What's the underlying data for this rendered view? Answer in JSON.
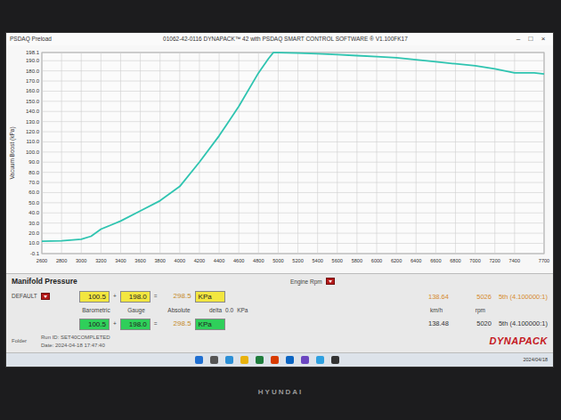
{
  "window": {
    "app_name": "PSDAQ Preload",
    "title": "01062-42-0116 DYNAPACK™ 42 with PSDAQ SMART CONTROL SOFTWARE ® V1.100FK17",
    "controls": [
      "–",
      "□",
      "×"
    ]
  },
  "chart": {
    "y_axis_label": "Vacuum Boost (kPa)",
    "x_axis_label": "Engine Rpm",
    "y_ticks": [
      "198.1",
      "190.0",
      "180.0",
      "170.0",
      "160.0",
      "150.0",
      "140.0",
      "130.0",
      "120.0",
      "110.0",
      "100.0",
      "90.0",
      "80.0",
      "70.0",
      "60.0",
      "50.0",
      "40.0",
      "30.0",
      "20.0",
      "10.0",
      "-0.1"
    ],
    "x_ticks": [
      "2600",
      "2800",
      "3000",
      "3200",
      "3400",
      "3600",
      "3800",
      "4000",
      "4200",
      "4400",
      "4600",
      "4800",
      "5000",
      "5200",
      "5400",
      "5600",
      "5800",
      "6000",
      "6200",
      "6400",
      "6600",
      "6800",
      "7000",
      "7200",
      "7400",
      "7700"
    ],
    "series": [
      {
        "name": "Manifold Pressure",
        "color": "#2ec4b0",
        "rpm": [
          2600,
          2800,
          3000,
          3100,
          3200,
          3300,
          3400,
          3600,
          3800,
          4000,
          4200,
          4400,
          4600,
          4800,
          4900,
          4950,
          5000,
          5200,
          5400,
          5600,
          5800,
          6000,
          6200,
          6400,
          6600,
          6800,
          7000,
          7200,
          7300,
          7400,
          7600,
          7700
        ],
        "values": [
          12,
          12.5,
          14,
          17,
          24,
          28,
          32,
          42,
          52,
          66,
          90,
          116,
          145,
          178,
          192,
          198,
          198,
          197.5,
          197,
          196,
          195,
          194,
          193,
          191,
          189,
          187,
          185,
          182,
          180,
          178,
          178,
          177
        ]
      }
    ]
  },
  "panel": {
    "title": "Manifold Pressure",
    "preset": "DEFAULT",
    "plus": "+",
    "equals": "=",
    "labels": {
      "barometric": "Barometric",
      "gauge": "Gauge",
      "absolute": "Absolute",
      "delta": "delta",
      "delta_value": "0.0",
      "delta_unit": "KPa",
      "speed": "km/h",
      "rpm": "rpm"
    },
    "readings": [
      {
        "barometric": "100.5",
        "gauge": "198.0",
        "absolute": "298.5",
        "unit": "KPa",
        "speed": "138.64",
        "rpm": "5026",
        "gear": "5th (4.100000:1)",
        "color": "#f2e640"
      },
      {
        "barometric": "100.5",
        "gauge": "198.0",
        "absolute": "298.5",
        "unit": "KPa",
        "speed": "138.48",
        "rpm": "5020",
        "gear": "5th (4.100000:1)",
        "color": "#2fcf5a"
      }
    ],
    "folder": "Folder",
    "run_id": "Run ID: SET40COMPLETED",
    "date": "Date: 2024-04-18 17:47:40",
    "logo": "DYNAPACK"
  },
  "taskbar": {
    "date": "2024/04/18"
  },
  "monitor": {
    "brand": "HYUNDAI"
  }
}
